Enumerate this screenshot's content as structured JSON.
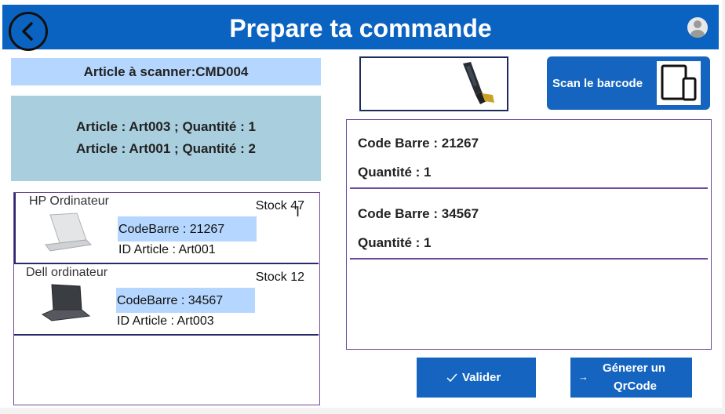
{
  "header": {
    "title": "Prepare ta commande",
    "back_icon": "chevron-left-icon",
    "user_icon": "user-avatar-icon"
  },
  "scan_label": "Article à scanner:CMD004",
  "order_articles": [
    "Article : Art003 ; Quantité : 1",
    "Article : Art001 ; Quantité : 2"
  ],
  "products": [
    {
      "name": "HP Ordinateur",
      "stock": "Stock 47",
      "code": "CodeBarre :  21267",
      "id": "ID Article :  Art001",
      "laptop_color": "#d9dadc"
    },
    {
      "name": "Dell ordinateur",
      "stock": "Stock 12",
      "code": "CodeBarre :  34567",
      "id": "ID Article :  Art003",
      "laptop_color": "#3a3d42"
    }
  ],
  "scan_button": {
    "label": "Scan le barcode",
    "icon": "tablet-phone-icon"
  },
  "scanner_icon": "handheld-scanner-icon",
  "scanned": [
    {
      "code": "Code Barre : 21267",
      "qty": "Quantité : 1"
    },
    {
      "code": "Code Barre : 34567",
      "qty": "Quantité : 1"
    }
  ],
  "actions": {
    "validate": {
      "label": "Valider",
      "icon": "check-icon"
    },
    "qrcode": {
      "label_line1": "Génerer un",
      "label_line2": "QrCode",
      "icon": "arrow-right-icon"
    }
  },
  "colors": {
    "header": "#0b63c1",
    "button": "#1565c0",
    "highlight": "#b5d7ff",
    "articles_bg": "#a9cfde",
    "border": "#6f4a9a"
  }
}
